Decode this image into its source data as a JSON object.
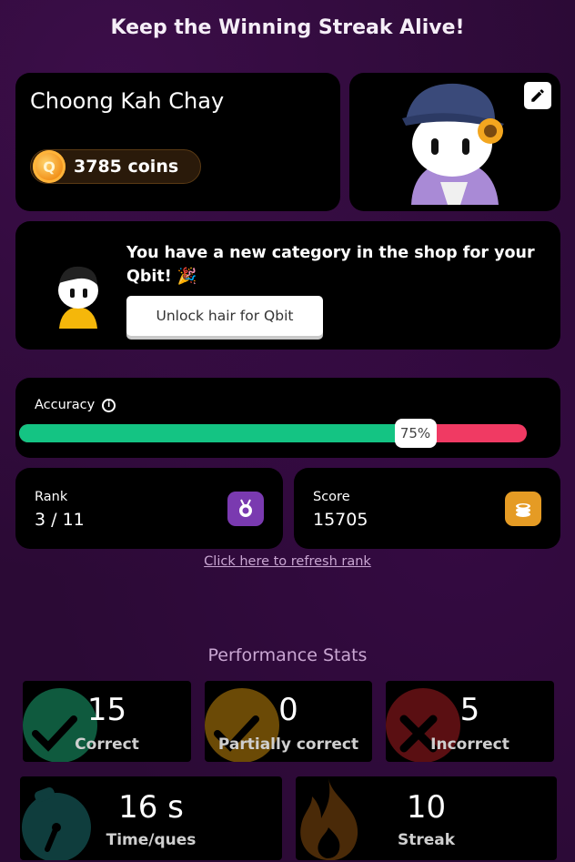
{
  "header": {
    "title": "Keep the Winning Streak Alive!"
  },
  "profile": {
    "name": "Choong Kah Chay",
    "coins_label": "3785 coins",
    "coin_icon": "q-coin-icon",
    "coin_symbol": "Q"
  },
  "avatar": {
    "edit_icon": "pencil-icon"
  },
  "shop": {
    "message": "You have a new category in the shop for your Qbit! 🎉",
    "button_label": "Unlock hair for Qbit"
  },
  "accuracy": {
    "label": "Accuracy",
    "info_icon": "info-icon",
    "percent": 75,
    "percent_label": "75%",
    "colors": {
      "correct": "#14c483",
      "incorrect": "#f03a63"
    }
  },
  "rank": {
    "label": "Rank",
    "value": "3 / 11",
    "icon": "medal-icon",
    "icon_color": "#7a3ab0"
  },
  "score": {
    "label": "Score",
    "value": "15705",
    "icon": "coin-stack-icon",
    "icon_color": "#e59b24"
  },
  "refresh_link": "Click here to refresh rank",
  "performance": {
    "title": "Performance Stats",
    "tiles": [
      {
        "value": "15",
        "label": "Correct",
        "icon": "check-icon",
        "color": "#0f5a3e"
      },
      {
        "value": "0",
        "label": "Partially correct",
        "icon": "check-icon",
        "color": "#6b4a06"
      },
      {
        "value": "5",
        "label": "Incorrect",
        "icon": "close-icon",
        "color": "#5a0f12"
      },
      {
        "value": "16 s",
        "label": "Time/ques",
        "icon": "stopwatch-icon",
        "color": "#0f3d3d"
      },
      {
        "value": "10",
        "label": "Streak",
        "icon": "fire-icon",
        "color": "#4a2a08"
      }
    ]
  }
}
